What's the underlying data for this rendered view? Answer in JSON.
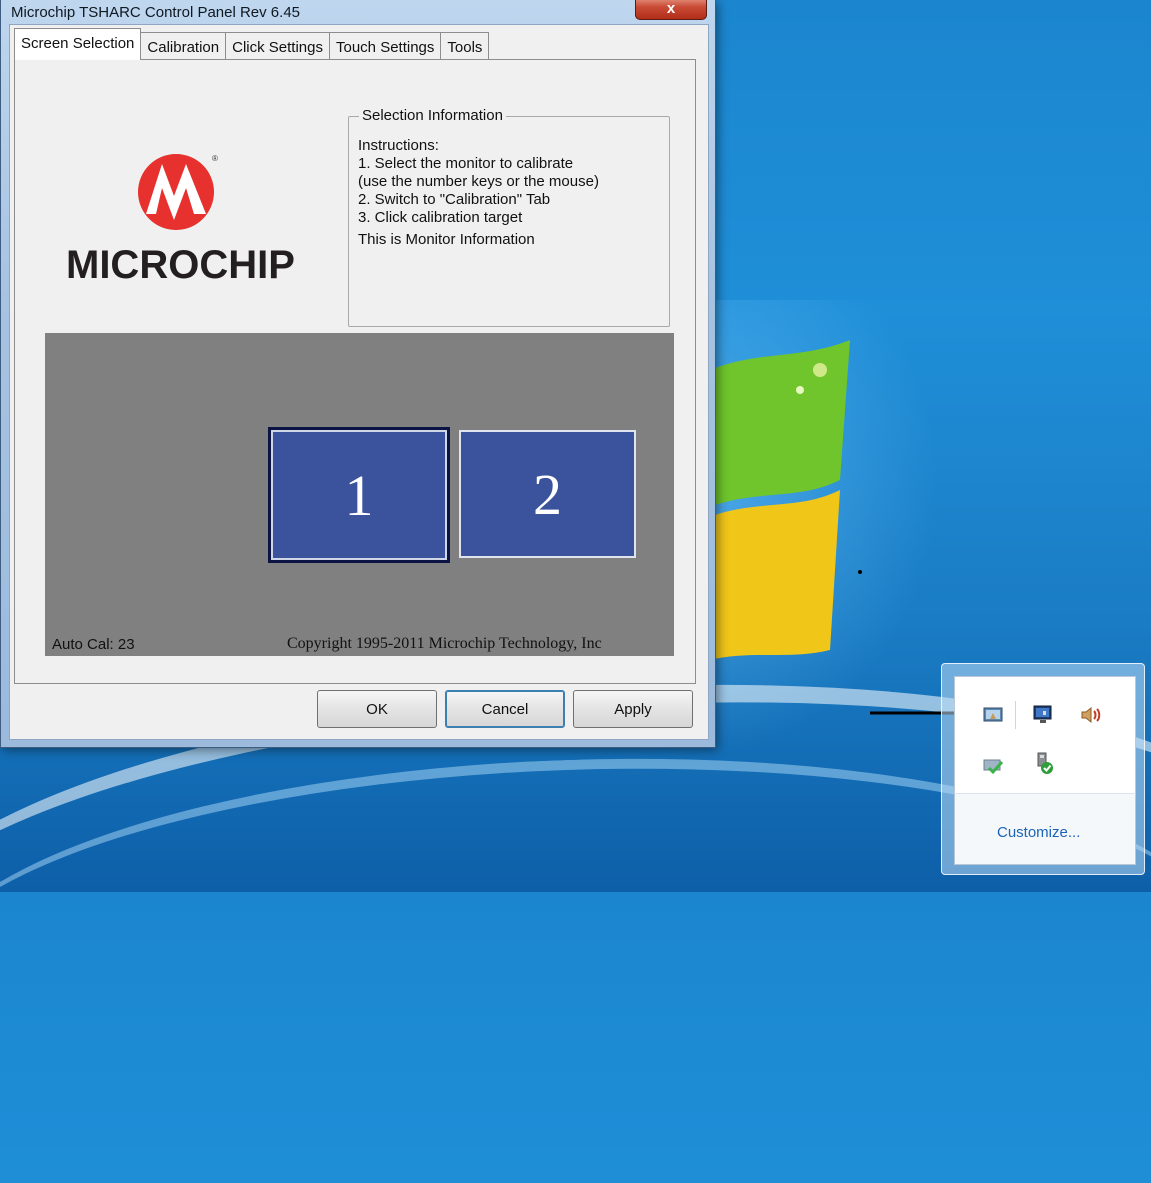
{
  "window": {
    "title": "Microchip TSHARC Control Panel Rev 6.45",
    "close_label": "x"
  },
  "tabs": [
    {
      "label": "Screen Selection"
    },
    {
      "label": "Calibration"
    },
    {
      "label": "Click Settings"
    },
    {
      "label": "Touch Settings"
    },
    {
      "label": "Tools"
    }
  ],
  "logo": {
    "text": "MICROCHIP"
  },
  "selection_info": {
    "legend": "Selection Information",
    "lines": [
      "Instructions:",
      "1. Select the monitor to calibrate",
      "(use the number keys or the mouse)",
      "2. Switch to \"Calibration\" Tab",
      "3. Click calibration target",
      "This is Monitor Information"
    ]
  },
  "monitors": [
    {
      "label": "1",
      "selected": true
    },
    {
      "label": "2",
      "selected": false
    }
  ],
  "status": {
    "auto_cal": "Auto Cal: 23",
    "copyright": "Copyright 1995-2011 Microchip Technology, Inc"
  },
  "buttons": {
    "ok": "OK",
    "cancel": "Cancel",
    "apply": "Apply"
  },
  "tray": {
    "icons": [
      "touchscreen-tray-icon",
      "network-monitor-icon",
      "speaker-icon",
      "action-center-icon",
      "usb-safely-remove-icon"
    ],
    "customize": "Customize..."
  },
  "colors": {
    "monitor_fill": "#3b539d",
    "monitor_area": "#808080",
    "logo_red": "#e6312e",
    "desktop_blue": "#1b86cf"
  }
}
